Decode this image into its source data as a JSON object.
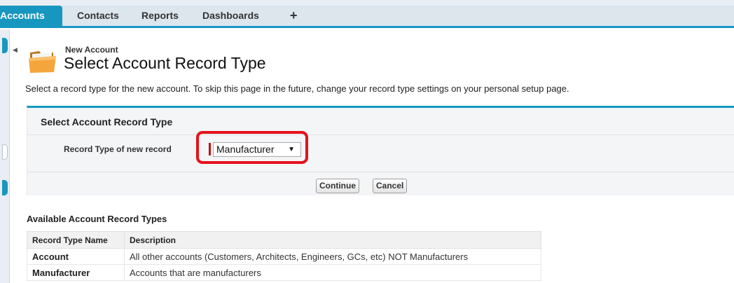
{
  "tabs": [
    {
      "label": "Accounts",
      "active": true
    },
    {
      "label": "Contacts",
      "active": false
    },
    {
      "label": "Reports",
      "active": false
    },
    {
      "label": "Dashboards",
      "active": false
    }
  ],
  "tab_add_label": "+",
  "header": {
    "breadcrumb": "New Account",
    "title": "Select Account Record Type",
    "icon": "folder-icon"
  },
  "intro_text": "Select a record type for the new account. To skip this page in the future, change your record type settings on your personal setup page.",
  "panel": {
    "title": "Select Account Record Type",
    "field_label": "Record Type of new record",
    "selected_value": "Manufacturer",
    "continue_label": "Continue",
    "cancel_label": "Cancel"
  },
  "available": {
    "heading": "Available Account Record Types",
    "columns": [
      "Record Type Name",
      "Description"
    ],
    "rows": [
      {
        "name": "Account",
        "description": "All other accounts (Customers, Architects, Engineers, GCs, etc) NOT Manufacturers"
      },
      {
        "name": "Manufacturer",
        "description": "Accounts that are manufacturers"
      }
    ]
  },
  "colors": {
    "accent": "#1797c0",
    "highlight": "#e4121b"
  }
}
